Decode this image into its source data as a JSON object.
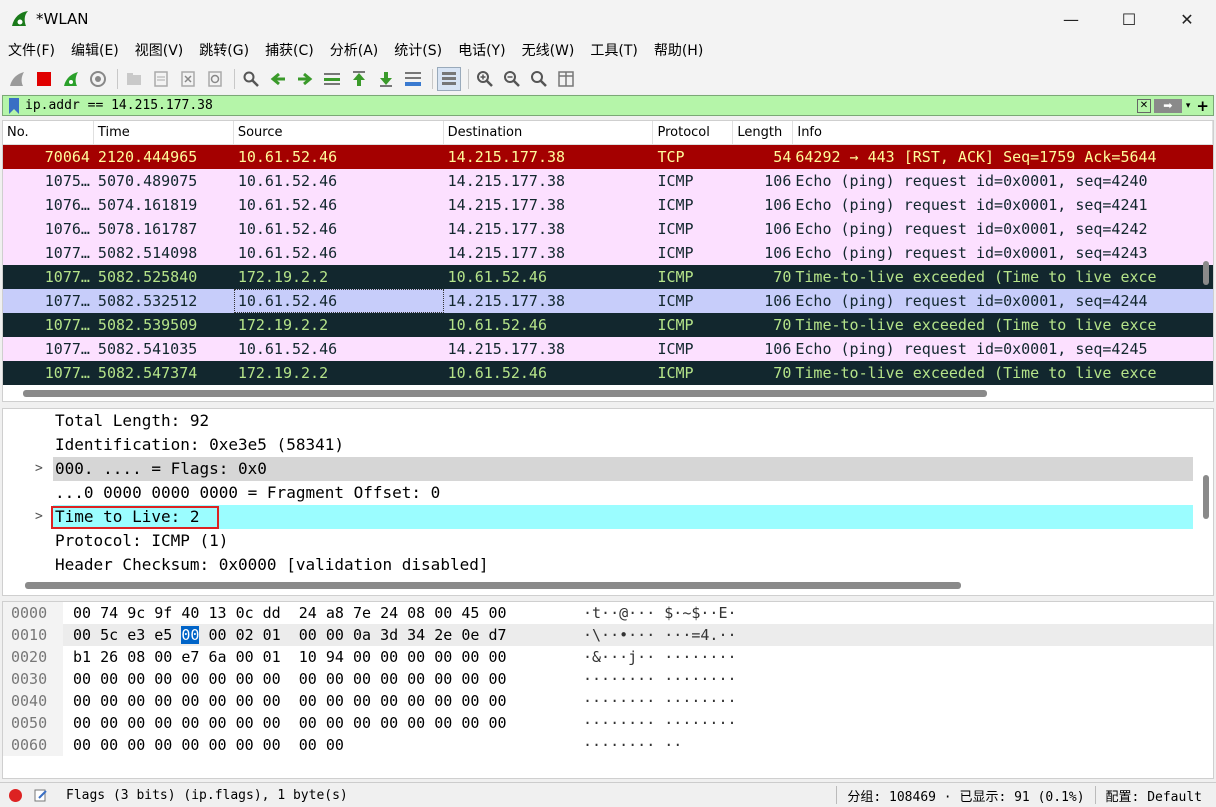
{
  "window": {
    "title": "*WLAN",
    "minimize": "—",
    "maximize": "☐",
    "close": "✕"
  },
  "menu": [
    "文件(F)",
    "编辑(E)",
    "视图(V)",
    "跳转(G)",
    "捕获(C)",
    "分析(A)",
    "统计(S)",
    "电话(Y)",
    "无线(W)",
    "工具(T)",
    "帮助(H)"
  ],
  "filter": {
    "value": "ip.addr == 14.215.177.38",
    "add": "+"
  },
  "columns": [
    "No.",
    "Time",
    "Source",
    "Destination",
    "Protocol",
    "Length",
    "Info"
  ],
  "packets": [
    {
      "no": "70064",
      "time": "2120.444965",
      "src": "10.61.52.46",
      "dst": "14.215.177.38",
      "proto": "TCP",
      "len": "54",
      "info": "64292 → 443 [RST, ACK] Seq=1759 Ack=5644",
      "style": "tcp"
    },
    {
      "no": "1075…",
      "time": "5070.489075",
      "src": "10.61.52.46",
      "dst": "14.215.177.38",
      "proto": "ICMP",
      "len": "106",
      "info": "Echo (ping) request  id=0x0001, seq=4240",
      "style": "icmp"
    },
    {
      "no": "1076…",
      "time": "5074.161819",
      "src": "10.61.52.46",
      "dst": "14.215.177.38",
      "proto": "ICMP",
      "len": "106",
      "info": "Echo (ping) request  id=0x0001, seq=4241",
      "style": "icmp"
    },
    {
      "no": "1076…",
      "time": "5078.161787",
      "src": "10.61.52.46",
      "dst": "14.215.177.38",
      "proto": "ICMP",
      "len": "106",
      "info": "Echo (ping) request  id=0x0001, seq=4242",
      "style": "icmp"
    },
    {
      "no": "1077…",
      "time": "5082.514098",
      "src": "10.61.52.46",
      "dst": "14.215.177.38",
      "proto": "ICMP",
      "len": "106",
      "info": "Echo (ping) request  id=0x0001, seq=4243",
      "style": "icmp"
    },
    {
      "no": "1077…",
      "time": "5082.525840",
      "src": "172.19.2.2",
      "dst": "10.61.52.46",
      "proto": "ICMP",
      "len": "70",
      "info": "Time-to-live exceeded (Time to live exce",
      "style": "ttl"
    },
    {
      "no": "1077…",
      "time": "5082.532512",
      "src": "10.61.52.46",
      "dst": "14.215.177.38",
      "proto": "ICMP",
      "len": "106",
      "info": "Echo (ping) request  id=0x0001, seq=4244",
      "style": "sel"
    },
    {
      "no": "1077…",
      "time": "5082.539509",
      "src": "172.19.2.2",
      "dst": "10.61.52.46",
      "proto": "ICMP",
      "len": "70",
      "info": "Time-to-live exceeded (Time to live exce",
      "style": "ttl"
    },
    {
      "no": "1077…",
      "time": "5082.541035",
      "src": "10.61.52.46",
      "dst": "14.215.177.38",
      "proto": "ICMP",
      "len": "106",
      "info": "Echo (ping) request  id=0x0001, seq=4245",
      "style": "icmp"
    },
    {
      "no": "1077…",
      "time": "5082.547374",
      "src": "172.19.2.2",
      "dst": "10.61.52.46",
      "proto": "ICMP",
      "len": "70",
      "info": "Time-to-live exceeded (Time to live exce",
      "style": "ttl"
    }
  ],
  "details": [
    {
      "text": "Total Length: 92",
      "expand": false,
      "style": ""
    },
    {
      "text": "Identification: 0xe3e5 (58341)",
      "expand": false,
      "style": ""
    },
    {
      "text": "000. .... = Flags: 0x0",
      "expand": true,
      "style": "gray"
    },
    {
      "text": "...0 0000 0000 0000 = Fragment Offset: 0",
      "expand": false,
      "style": ""
    },
    {
      "text": "Time to Live: 2",
      "expand": true,
      "style": "cyan"
    },
    {
      "text": "Protocol: ICMP (1)",
      "expand": false,
      "style": ""
    },
    {
      "text": "Header Checksum: 0x0000 [validation disabled]",
      "expand": false,
      "style": ""
    }
  ],
  "bytes": [
    {
      "offset": "0000",
      "hex": [
        "00",
        "74",
        "9c",
        "9f",
        "40",
        "13",
        "0c",
        "dd",
        "24",
        "a8",
        "7e",
        "24",
        "08",
        "00",
        "45",
        "00"
      ],
      "ascii": "·t··@··· $·~$··E·"
    },
    {
      "offset": "0010",
      "hex": [
        "00",
        "5c",
        "e3",
        "e5",
        "00",
        "00",
        "02",
        "01",
        "00",
        "00",
        "0a",
        "3d",
        "34",
        "2e",
        "0e",
        "d7"
      ],
      "ascii": "·\\··•··· ···=4.··"
    },
    {
      "offset": "0020",
      "hex": [
        "b1",
        "26",
        "08",
        "00",
        "e7",
        "6a",
        "00",
        "01",
        "10",
        "94",
        "00",
        "00",
        "00",
        "00",
        "00",
        "00"
      ],
      "ascii": "·&···j·· ········"
    },
    {
      "offset": "0030",
      "hex": [
        "00",
        "00",
        "00",
        "00",
        "00",
        "00",
        "00",
        "00",
        "00",
        "00",
        "00",
        "00",
        "00",
        "00",
        "00",
        "00"
      ],
      "ascii": "········ ········"
    },
    {
      "offset": "0040",
      "hex": [
        "00",
        "00",
        "00",
        "00",
        "00",
        "00",
        "00",
        "00",
        "00",
        "00",
        "00",
        "00",
        "00",
        "00",
        "00",
        "00"
      ],
      "ascii": "········ ········"
    },
    {
      "offset": "0050",
      "hex": [
        "00",
        "00",
        "00",
        "00",
        "00",
        "00",
        "00",
        "00",
        "00",
        "00",
        "00",
        "00",
        "00",
        "00",
        "00",
        "00"
      ],
      "ascii": "········ ········"
    },
    {
      "offset": "0060",
      "hex": [
        "00",
        "00",
        "00",
        "00",
        "00",
        "00",
        "00",
        "00",
        "00",
        "00"
      ],
      "ascii": "········ ··"
    }
  ],
  "status": {
    "field": "Flags (3 bits) (ip.flags), 1 byte(s)",
    "packets": "分组: 108469 · 已显示: 91 (0.1%)",
    "profile": "配置: Default"
  }
}
